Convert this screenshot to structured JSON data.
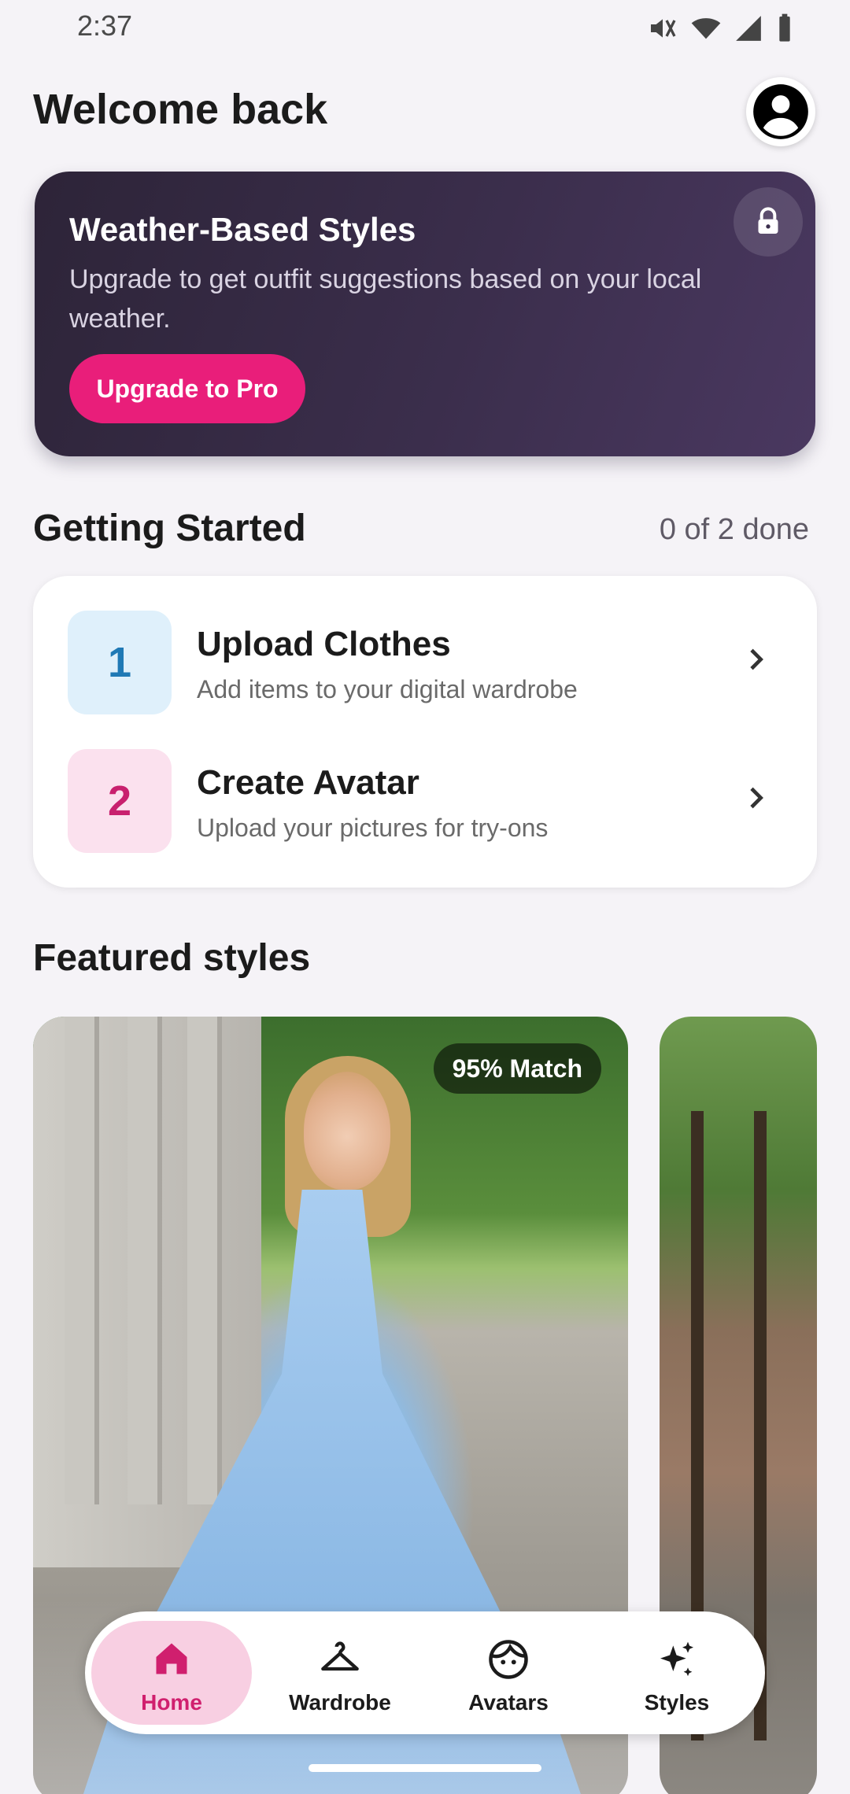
{
  "status_bar": {
    "time": "2:37"
  },
  "header": {
    "title": "Welcome back"
  },
  "weather_card": {
    "title": "Weather-Based Styles",
    "description": "Upgrade to get outfit suggestions based on your local weather.",
    "button_label": "Upgrade to Pro"
  },
  "getting_started": {
    "title": "Getting Started",
    "progress": "0 of 2 done",
    "items": [
      {
        "number": "1",
        "title": "Upload Clothes",
        "subtitle": "Add items to your digital wardrobe"
      },
      {
        "number": "2",
        "title": "Create Avatar",
        "subtitle": "Upload your pictures for try-ons"
      }
    ]
  },
  "featured": {
    "title": "Featured styles",
    "cards": [
      {
        "match": "95% Match"
      }
    ]
  },
  "bottom_nav": {
    "items": [
      {
        "label": "Home",
        "icon": "home-icon",
        "active": true
      },
      {
        "label": "Wardrobe",
        "icon": "hanger-icon"
      },
      {
        "label": "Avatars",
        "icon": "face-icon"
      },
      {
        "label": "Styles",
        "icon": "sparkle-icon"
      }
    ]
  },
  "colors": {
    "accent": "#e91e7a",
    "card_dark": "#3b2e4c",
    "active_nav_bg": "#f8cfe2"
  }
}
